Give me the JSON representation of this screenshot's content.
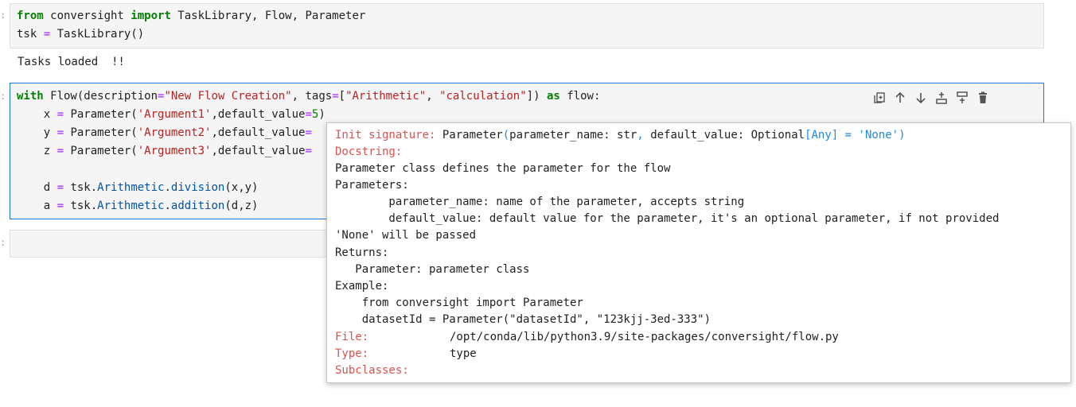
{
  "cell1": {
    "prompt": ":",
    "line1": {
      "kw_from": "from",
      "module": " conversight ",
      "kw_import": "import",
      "names": " TaskLibrary, Flow, Parameter"
    },
    "line2": {
      "var": "tsk ",
      "eq": "=",
      "rest": " TaskLibrary()"
    }
  },
  "output1": {
    "text": "Tasks loaded  !!"
  },
  "cell2": {
    "prompt": ":",
    "line1": {
      "kw_with": "with",
      "p1": " Flow(description",
      "eq1": "=",
      "s1": "\"New Flow Creation\"",
      "p2": ", tags",
      "eq2": "=",
      "p3": "[",
      "s2": "\"Arithmetic\"",
      "p4": ", ",
      "s3": "\"calculation\"",
      "p5": "]) ",
      "kw_as": "as",
      "p6": " flow:"
    },
    "line_x": {
      "var": "    x ",
      "eq": "=",
      "p1": " Parameter(",
      "s": "'Argument1'",
      "p2": ",default_value",
      "eq2": "=",
      "num": "5",
      "p3": ")"
    },
    "line_y": {
      "var": "    y ",
      "eq": "=",
      "p1": " Parameter(",
      "s": "'Argument2'",
      "p2": ",default_value",
      "eq2": "="
    },
    "line_z": {
      "var": "    z ",
      "eq": "=",
      "p1": " Parameter(",
      "s": "'Argument3'",
      "p2": ",default_value",
      "eq2": "="
    },
    "line_d": {
      "var": "    d ",
      "eq": "=",
      "p1": " tsk.",
      "attr1": "Arithmetic",
      "p2": ".",
      "attr2": "division",
      "p3": "(x,y)"
    },
    "line_a": {
      "var": "    a ",
      "eq": "=",
      "p1": " tsk.",
      "attr1": "Arithmetic",
      "p2": ".",
      "attr2": "addition",
      "p3": "(d,z)"
    }
  },
  "cell3": {
    "prompt": ":"
  },
  "toolbar": {
    "icons": [
      "duplicate-icon",
      "move-up-icon",
      "move-down-icon",
      "insert-above-icon",
      "insert-below-icon",
      "delete-icon"
    ]
  },
  "tooltip": {
    "init_label": "Init signature:",
    "init_p1": " Parameter",
    "init_p2": "(",
    "init_p3": "parameter_name: str",
    "init_p4": ",",
    "init_p5": " default_value: Optional",
    "init_p6": "[Any]",
    "init_p7": " = ",
    "init_p8": "'None'",
    "init_p9": ")",
    "doc_label": "Docstring:",
    "doc_lines": [
      "Parameter class defines the parameter for the flow",
      "Parameters:",
      "        parameter_name: name of the parameter, accepts string",
      "        default_value: default value for the parameter, it's an optional parameter, if not provided",
      "'None' will be passed",
      "Returns:",
      "   Parameter: parameter class",
      "Example:",
      "    from conversight import Parameter",
      "    datasetId = Parameter(\"datasetId\", \"123kjj-3ed-333\")"
    ],
    "file_label": "File:",
    "file_value": "/opt/conda/lib/python3.9/site-packages/conversight/flow.py",
    "type_label": "Type:",
    "type_value": "type",
    "subclasses_label": "Subclasses:"
  }
}
